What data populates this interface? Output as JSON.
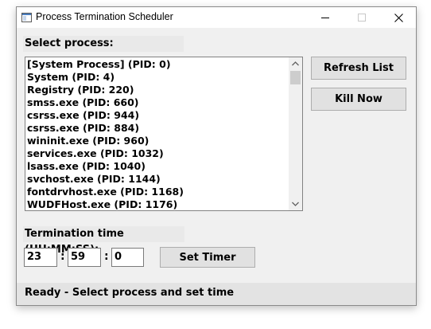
{
  "window": {
    "title": "Process Termination Scheduler"
  },
  "process_section": {
    "label": "Select process:",
    "items": [
      "[System Process] (PID: 0)",
      "System (PID: 4)",
      "Registry (PID: 220)",
      "smss.exe (PID: 660)",
      "csrss.exe (PID: 944)",
      "csrss.exe (PID: 884)",
      "wininit.exe (PID: 960)",
      "services.exe (PID: 1032)",
      "lsass.exe (PID: 1040)",
      "svchost.exe (PID: 1144)",
      "fontdrvhost.exe (PID: 1168)",
      "WUDFHost.exe (PID: 1176)"
    ]
  },
  "buttons": {
    "refresh": "Refresh List",
    "kill": "Kill Now",
    "set_timer": "Set Timer"
  },
  "time_section": {
    "label": "Termination time (HH:MM:SS):",
    "hours": "23",
    "minutes": "59",
    "seconds": "0",
    "separator": ":"
  },
  "status": {
    "text": "Ready - Select process and set time"
  },
  "icons": {
    "app": "window-app-icon",
    "minimize": "minimize-icon",
    "maximize": "maximize-icon",
    "close": "close-icon",
    "scroll_up": "chevron-up-icon",
    "scroll_down": "chevron-down-icon"
  }
}
